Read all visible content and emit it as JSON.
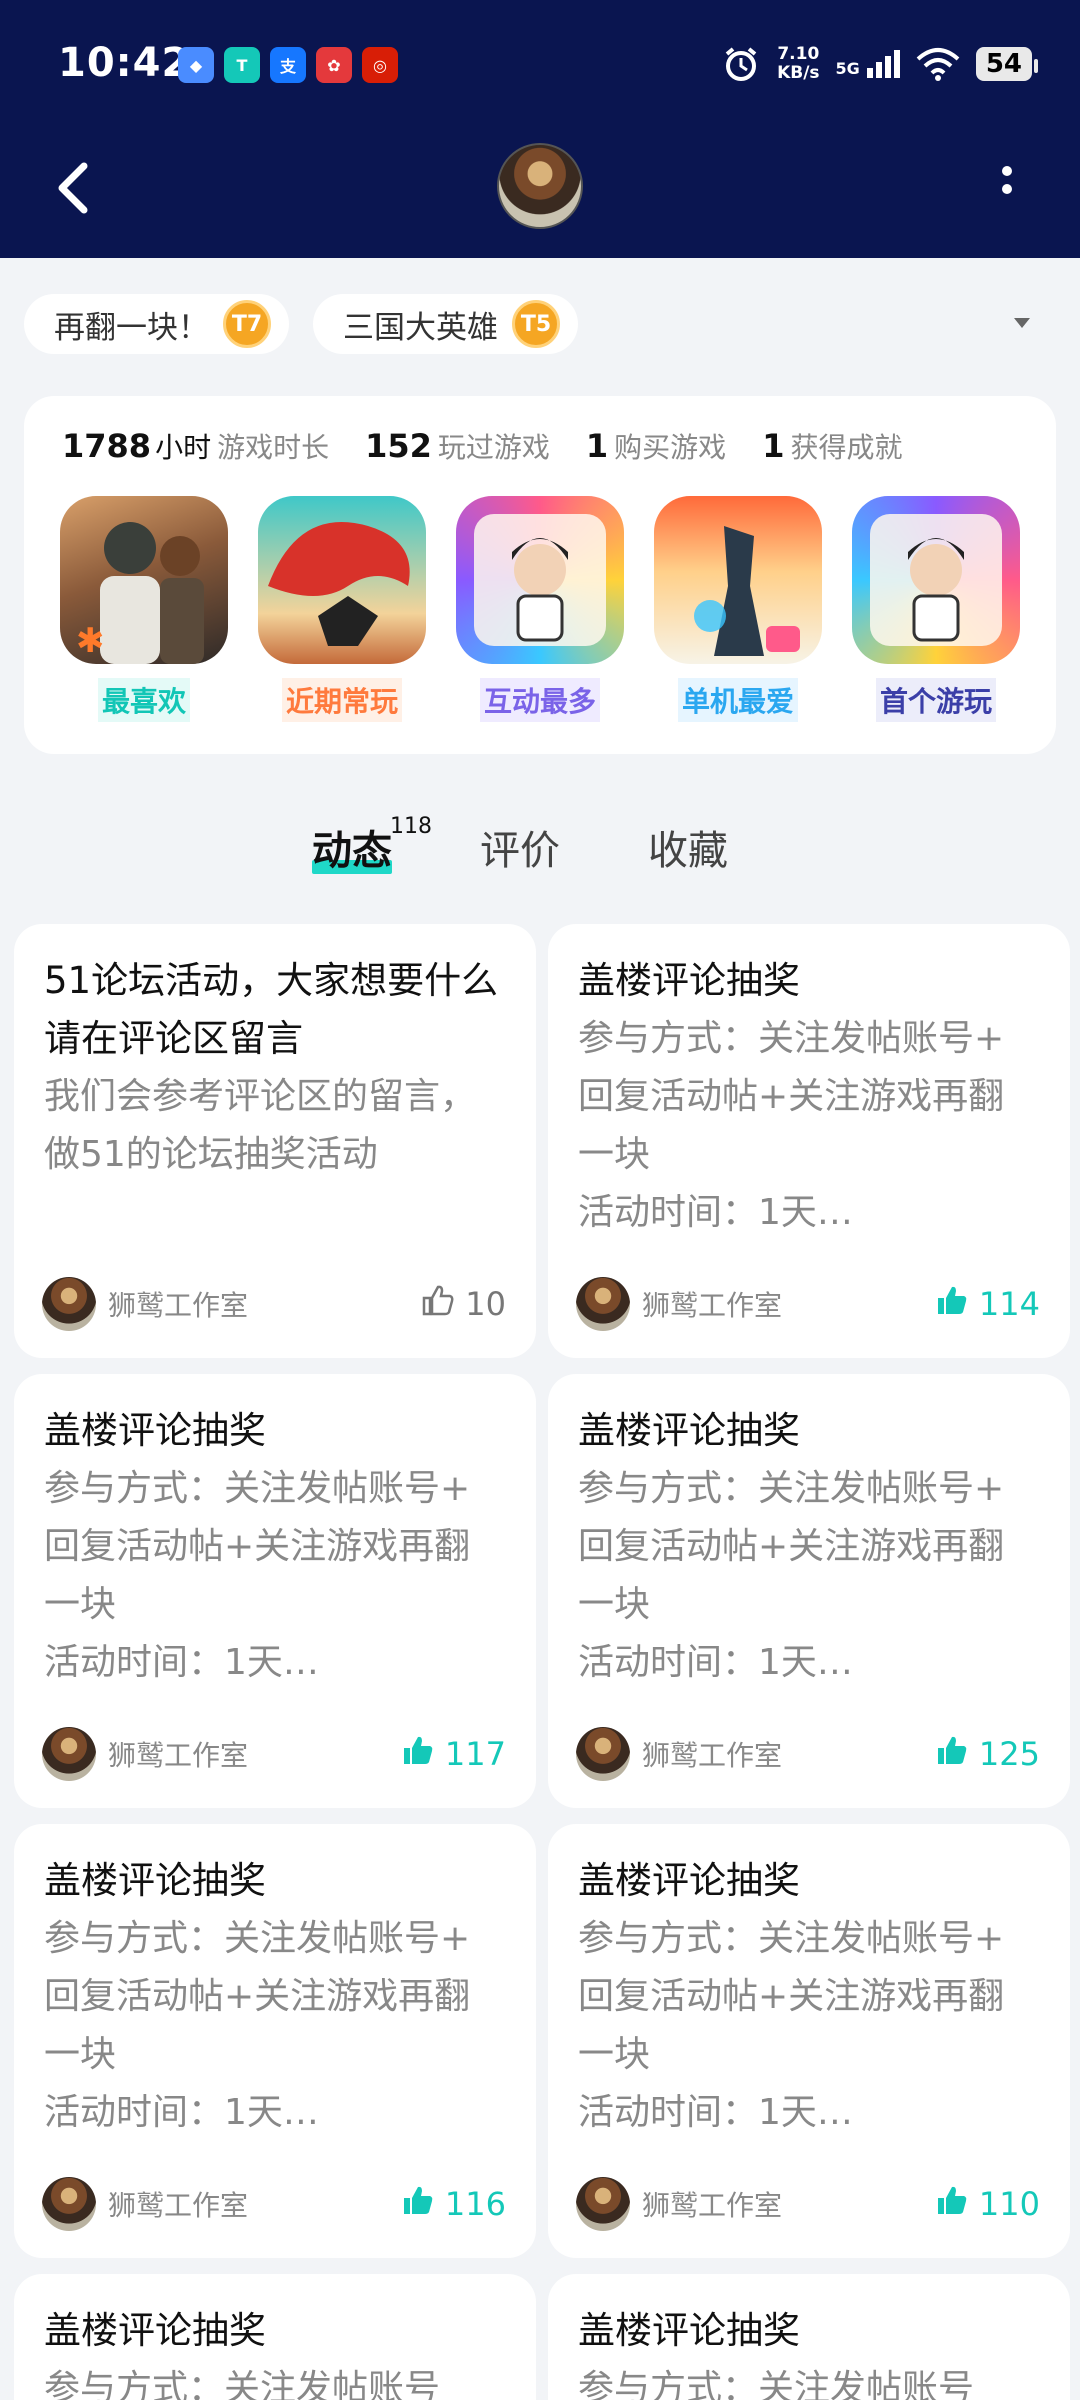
{
  "status_bar": {
    "time": "10:42",
    "net_speed": "7.10",
    "net_unit": "KB/s",
    "signal": "5G",
    "battery": "54"
  },
  "header": {
    "back_icon": "back-chevron-icon",
    "more_icon": "more-vertical-icon"
  },
  "tags": [
    {
      "label": "再翻一块！",
      "badge": "T7"
    },
    {
      "label": "三国大英雄",
      "badge": "T5"
    }
  ],
  "stats": [
    {
      "value": "1788",
      "unit": "小时",
      "label": "游戏时长"
    },
    {
      "value": "152",
      "unit": "",
      "label": "玩过游戏"
    },
    {
      "value": "1",
      "unit": "",
      "label": "购买游戏"
    },
    {
      "value": "1",
      "unit": "",
      "label": "获得成就"
    }
  ],
  "games": [
    {
      "label": "最喜欢",
      "color": "#12c6b6",
      "bg": "#e4faf7"
    },
    {
      "label": "近期常玩",
      "color": "#ff7a3d",
      "bg": "#fff0e6"
    },
    {
      "label": "互动最多",
      "color": "#7a63e8",
      "bg": "#efebff"
    },
    {
      "label": "单机最爱",
      "color": "#2aa7f0",
      "bg": "#e6f5ff"
    },
    {
      "label": "首个游玩",
      "color": "#3b3fa8",
      "bg": "#ecedfa"
    }
  ],
  "tabs": [
    {
      "label": "动态",
      "count": "118"
    },
    {
      "label": "评价"
    },
    {
      "label": "收藏"
    }
  ],
  "posts": [
    {
      "title": "51论坛活动，大家想要什么请在评论区留言",
      "body": "我们会参考评论区的留言，做51的论坛抽奖活动",
      "author": "狮鹫工作室",
      "likes": "10",
      "liked": false
    },
    {
      "title": "盖楼评论抽奖",
      "body": "参与方式：关注发帖账号+ 回复活动帖+关注游戏再翻一块\n活动时间：1天…",
      "author": "狮鹫工作室",
      "likes": "114",
      "liked": true
    },
    {
      "title": "盖楼评论抽奖",
      "body": "参与方式：关注发帖账号+ 回复活动帖+关注游戏再翻一块\n活动时间：1天…",
      "author": "狮鹫工作室",
      "likes": "117",
      "liked": true
    },
    {
      "title": "盖楼评论抽奖",
      "body": "参与方式：关注发帖账号+ 回复活动帖+关注游戏再翻一块\n活动时间：1天…",
      "author": "狮鹫工作室",
      "likes": "125",
      "liked": true
    },
    {
      "title": "盖楼评论抽奖",
      "body": "参与方式：关注发帖账号+ 回复活动帖+关注游戏再翻一块\n活动时间：1天…",
      "author": "狮鹫工作室",
      "likes": "116",
      "liked": true
    },
    {
      "title": "盖楼评论抽奖",
      "body": "参与方式：关注发帖账号+ 回复活动帖+关注游戏再翻一块\n活动时间：1天…",
      "author": "狮鹫工作室",
      "likes": "110",
      "liked": true
    },
    {
      "title": "盖楼评论抽奖",
      "body": "参与方式：关注发帖账号",
      "author": "",
      "likes": "",
      "liked": true
    },
    {
      "title": "盖楼评论抽奖",
      "body": "参与方式：关注发帖账号",
      "author": "",
      "likes": "",
      "liked": true
    }
  ]
}
